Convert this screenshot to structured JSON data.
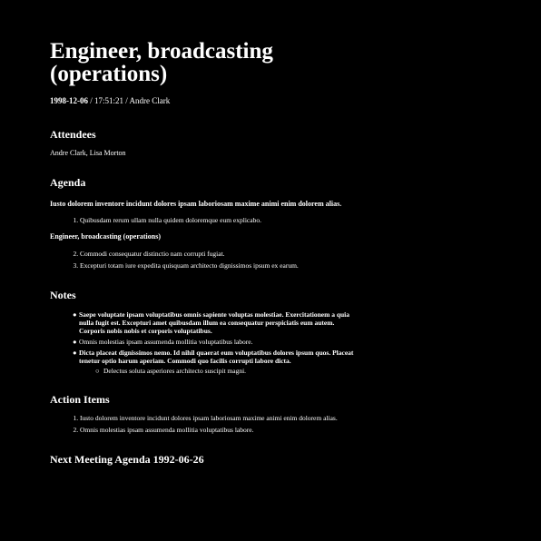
{
  "title": "Engineer, broadcasting (operations)",
  "meta": {
    "date": "1998-12-06",
    "time": "17:51:21",
    "author": "Andre Clark",
    "sep": " / "
  },
  "attendees": {
    "heading": "Attendees",
    "names": "Andre Clark, Lisa Morton"
  },
  "agenda": {
    "heading": "Agenda",
    "intro": "Iusto dolorem inventore incidunt dolores ipsam laboriosam maxime animi enim dolorem alias.",
    "items1": [
      "Quibusdam rerum ullam nulla quidem doloremque eum explicabo."
    ],
    "subheading": "Engineer, broadcasting (operations)",
    "items2": [
      "Commodi consequatur distinctio nam corrupti fugiat.",
      "Excepturi totam iure expedita quisquam architecto dignissimos ipsum ex earum."
    ]
  },
  "notes": {
    "heading": "Notes",
    "items": [
      "Saepe voluptate ipsam voluptatibus omnis sapiente voluptas molestiae. Exercitationem a quia nulla fugit est. Excepturi amet quibusdam illum ea consequatur perspiciatis eum autem. Corporis nobis nobis et corporis voluptatibus.",
      "Omnis molestias ipsam assumenda mollitia voluptatibus labore.",
      "Dicta placeat dignissimos nemo. Id nihil quaerat eum voluptatibus dolores ipsum quos. Placeat tenetur optio harum aperiam. Commodi quo facilis corrupti labore dicta."
    ],
    "subitem": "Delectus soluta asperiores architecto suscipit magni."
  },
  "action_items": {
    "heading": "Action Items",
    "items": [
      "Iusto dolorem inventore incidunt dolores ipsam laboriosam maxime animi enim dolorem alias.",
      "Omnis molestias ipsam assumenda mollitia voluptatibus labore."
    ]
  },
  "next_meeting": {
    "label": "Next Meeting Agenda",
    "date": "1992-06-26"
  }
}
